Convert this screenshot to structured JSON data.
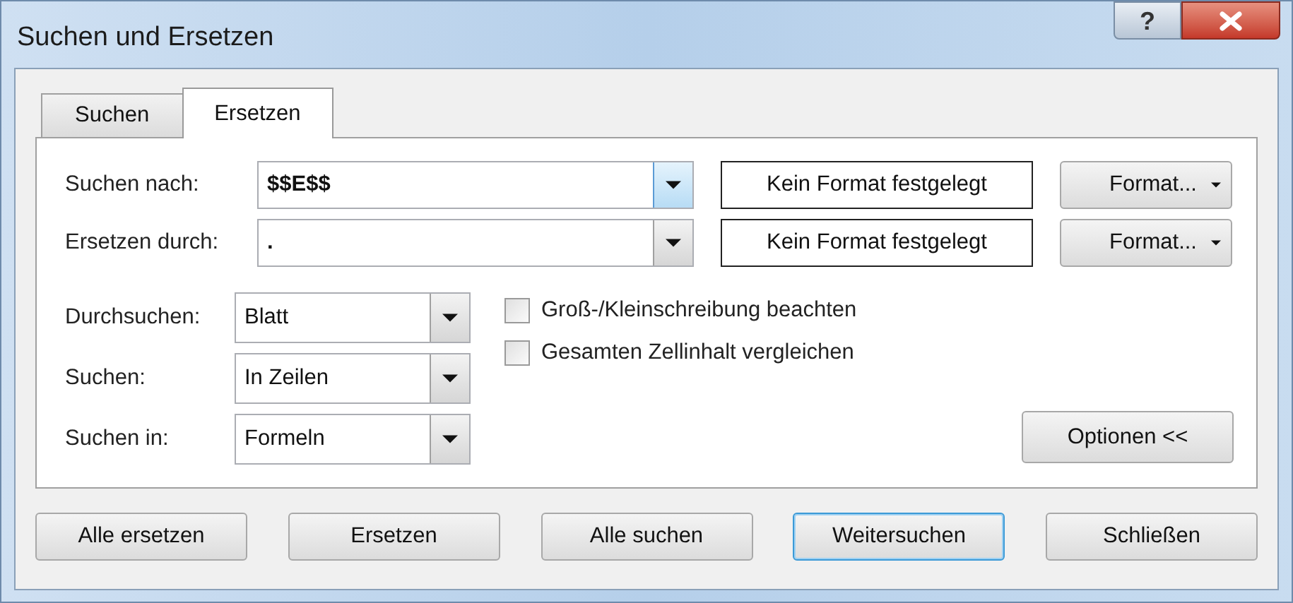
{
  "window": {
    "title": "Suchen und Ersetzen",
    "help_button": "?"
  },
  "tabs": [
    {
      "label": "Suchen",
      "selected": false
    },
    {
      "label": "Ersetzen",
      "selected": true
    }
  ],
  "fields": [
    {
      "label": "Suchen nach:",
      "value": "$$E$$",
      "arrow_highlighted": true,
      "format_preview": "Kein Format festgelegt",
      "format_button": "Format..."
    },
    {
      "label": "Ersetzen durch:",
      "value": ".",
      "arrow_highlighted": false,
      "format_preview": "Kein Format festgelegt",
      "format_button": "Format..."
    }
  ],
  "selects": [
    {
      "label": "Durchsuchen:",
      "value": "Blatt"
    },
    {
      "label": "Suchen:",
      "value": "In Zeilen"
    },
    {
      "label": "Suchen in:",
      "value": "Formeln"
    }
  ],
  "checkboxes": [
    {
      "label": "Groß-/Kleinschreibung beachten",
      "checked": false
    },
    {
      "label": "Gesamten Zellinhalt vergleichen",
      "checked": false
    }
  ],
  "options_button": "Optionen <<",
  "buttons": [
    {
      "label": "Alle ersetzen",
      "focused": false
    },
    {
      "label": "Ersetzen",
      "focused": false
    },
    {
      "label": "Alle suchen",
      "focused": false
    },
    {
      "label": "Weitersuchen",
      "focused": true
    },
    {
      "label": "Schließen",
      "focused": false
    }
  ]
}
